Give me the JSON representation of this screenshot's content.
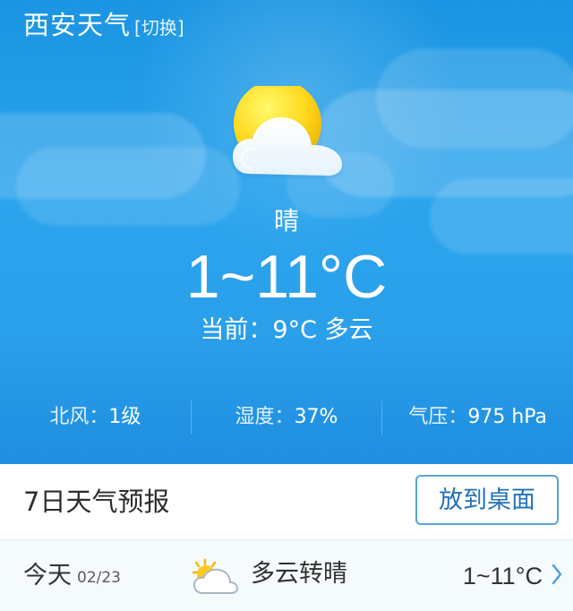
{
  "header": {
    "city_title": "西安天气",
    "switch_label": "[切换]"
  },
  "current_weather": {
    "condition": "晴",
    "temperature_range": "1~11°C",
    "current_label": "当前：9°C 多云",
    "icon": "sun-cloud-icon"
  },
  "stats": [
    {
      "label": "北风：",
      "value": "1级"
    },
    {
      "label": "湿度：",
      "value": "37%"
    },
    {
      "label": "气压：",
      "value": "975 hPa"
    }
  ],
  "forecast": {
    "title": "7日天气预报",
    "desktop_button": "放到桌面",
    "items": [
      {
        "day": "今天",
        "date": "02/23",
        "icon": "partly-cloudy-sun-icon",
        "description": "多云转晴",
        "temp_range": "1~11°C"
      }
    ]
  },
  "colors": {
    "sky_blue": "#2aa2ec",
    "white": "#ffffff",
    "button_border": "#5ba3d6",
    "button_text": "#2271b8",
    "forecast_row_bg": "#f5fafc"
  }
}
